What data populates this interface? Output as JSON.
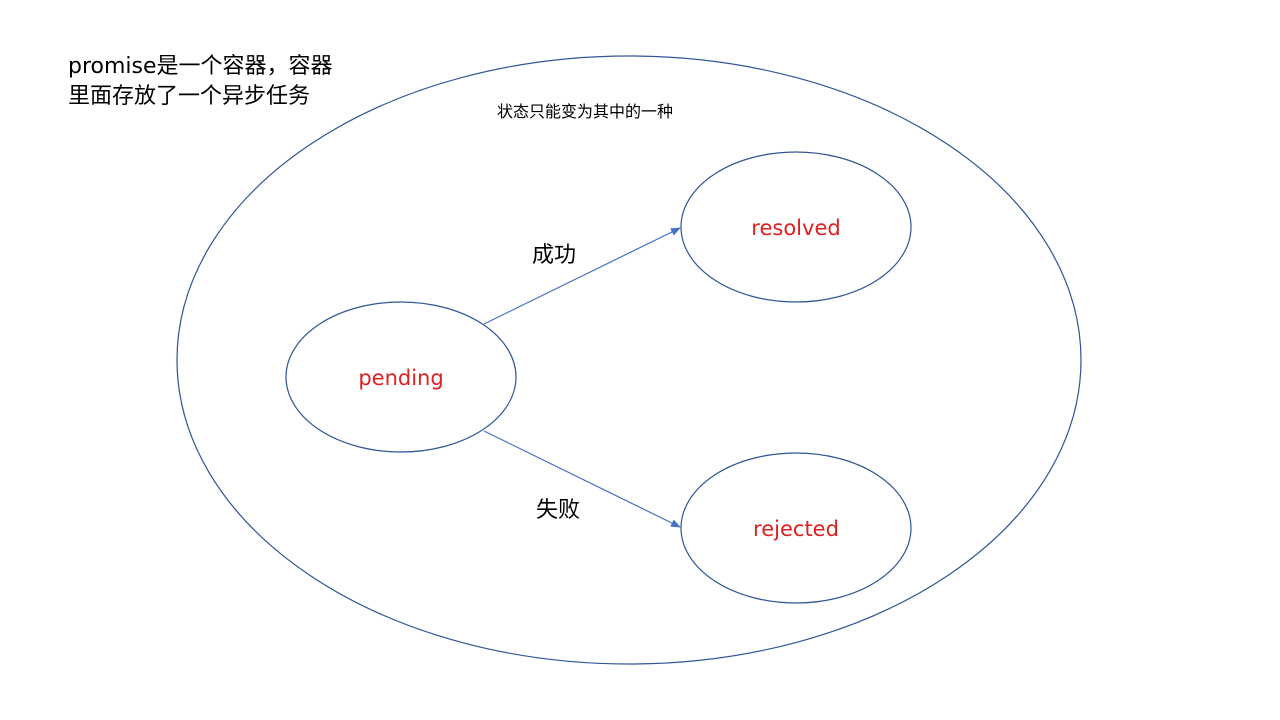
{
  "note": {
    "line1": "promise是一个容器，容器",
    "line2": "里面存放了一个异步任务"
  },
  "container": {
    "caption": "状态只能变为其中的一种"
  },
  "states": {
    "pending": "pending",
    "resolved": "resolved",
    "rejected": "rejected"
  },
  "transitions": {
    "success": "成功",
    "failure": "失败"
  },
  "colors": {
    "outline": "#2f5597",
    "arrow": "#4472c4",
    "state_text": "#e02020",
    "label_text": "#000000"
  }
}
